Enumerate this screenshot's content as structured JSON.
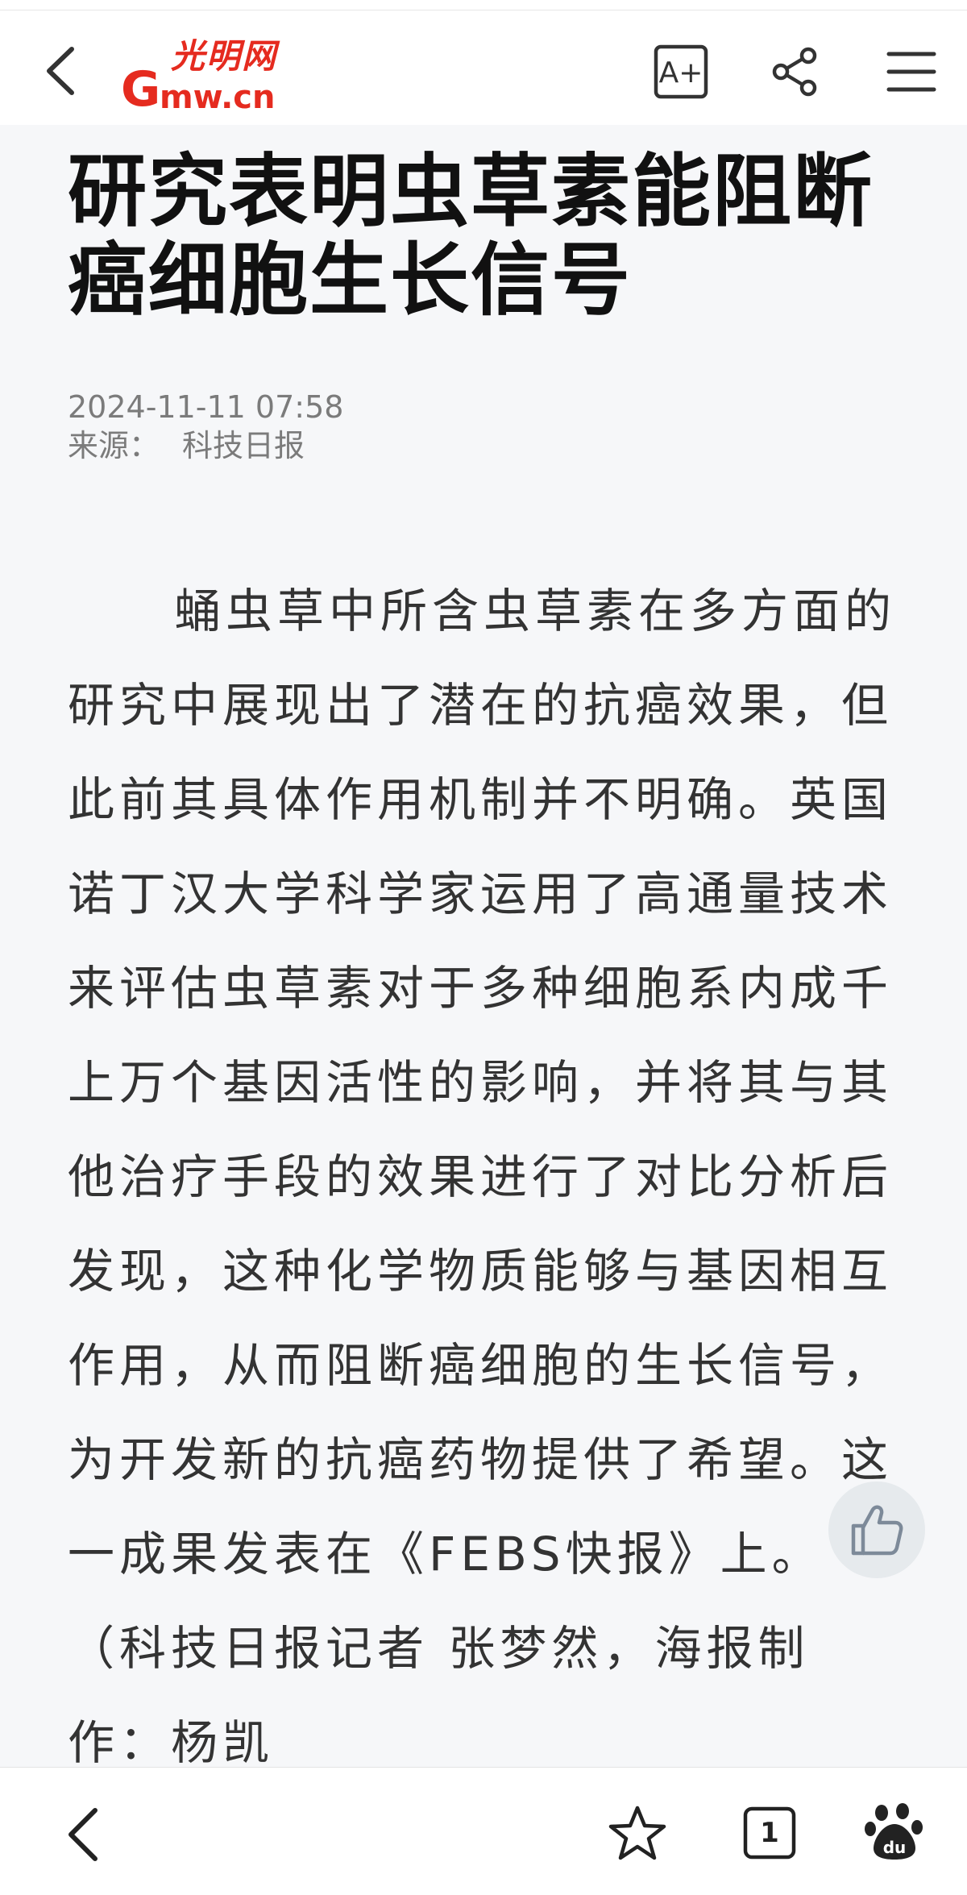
{
  "header": {
    "logo_cn": "光明网",
    "logo_g": "G",
    "logo_domain": "mw.cn",
    "font_size_button": "A+"
  },
  "article": {
    "title": "研究表明虫草素能阻断癌细胞生长信号",
    "datetime": "2024-11-11 07:58",
    "source_label": "来源：",
    "source_name": "科技日报",
    "body": "蛹虫草中所含虫草素在多方面的研究中展现出了潜在的抗癌效果，但此前其具体作用机制并不明确。英国诺丁汉大学科学家运用了高通量技术来评估虫草素对于多种细胞系内成千上万个基因活性的影响，并将其与其他治疗手段的效果进行了对比分析后发现，这种化学物质能够与基因相互作用，从而阻断癌细胞的生长信号，为开发新的抗癌药物提供了希望。这一成果发表在《FEBS快报》上。（科技日报记者 张梦然，海报制作：杨凯"
  },
  "bottom_bar": {
    "tab_count": "1"
  },
  "icons": {
    "back": "chevron-left-icon",
    "font_size": "font-size-icon",
    "share": "share-icon",
    "menu": "hamburger-menu-icon",
    "like": "thumbs-up-icon",
    "favorite": "star-icon",
    "tabs": "tabs-icon",
    "baidu": "baidu-paw-icon"
  },
  "colors": {
    "brand_red": "#e52b1f",
    "title_text": "#111111",
    "body_text": "#333333",
    "meta_text": "#7b7b7b",
    "background": "#f6f7f9"
  }
}
